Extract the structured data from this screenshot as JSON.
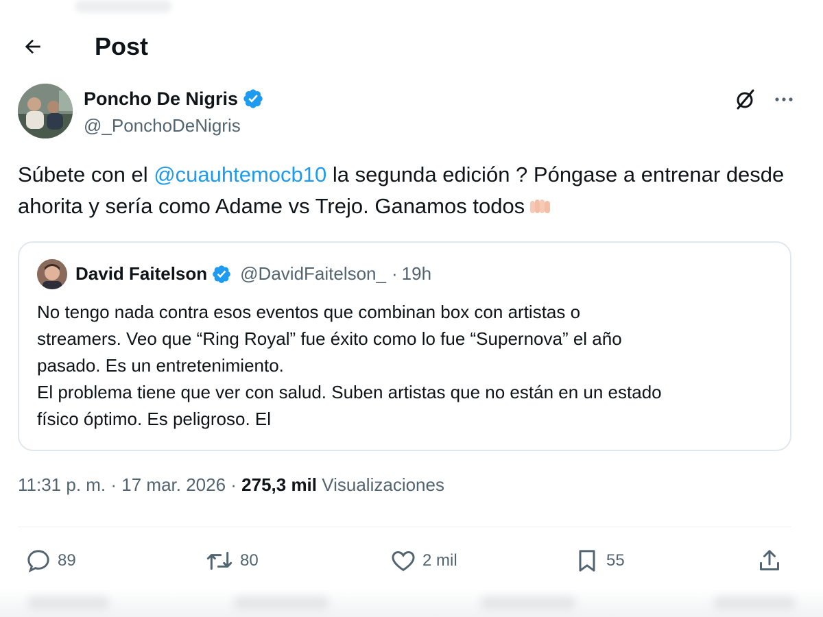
{
  "header": {
    "title": "Post"
  },
  "author": {
    "name": "Poncho De Nigris",
    "handle": "@_PonchoDeNigris"
  },
  "tweet": {
    "text_before": "Súbete con el ",
    "mention": "@cuauhtemocb10",
    "text_after": "  la segunda edición ? Póngase a entrenar desde ahorita y sería como Adame vs Trejo. Ganamos todos"
  },
  "quote": {
    "name": "David Faitelson",
    "handle": "@DavidFaitelson_",
    "separator": "·",
    "time": "19h",
    "lines": [
      "No tengo nada contra esos eventos que combinan box con artistas o",
      "streamers. Veo que “Ring Royal” fue éxito como lo fue “Supernova” el año",
      "pasado. Es un entretenimiento.",
      "El problema tiene que ver con salud. Suben artistas que no están en un estado",
      "físico óptimo. Es peligroso. El"
    ]
  },
  "meta": {
    "time": "11:31 p. m.",
    "sep1": " · ",
    "date": "17 mar. 2026",
    "sep2": " · ",
    "views": "275,3 mil",
    "views_label": " Visualizaciones"
  },
  "actions": {
    "replies": "89",
    "reposts": "80",
    "likes": "2 mil",
    "bookmarks": "55"
  },
  "colors": {
    "accent": "#1d9bf0",
    "muted": "#536471",
    "text": "#0f1419"
  }
}
